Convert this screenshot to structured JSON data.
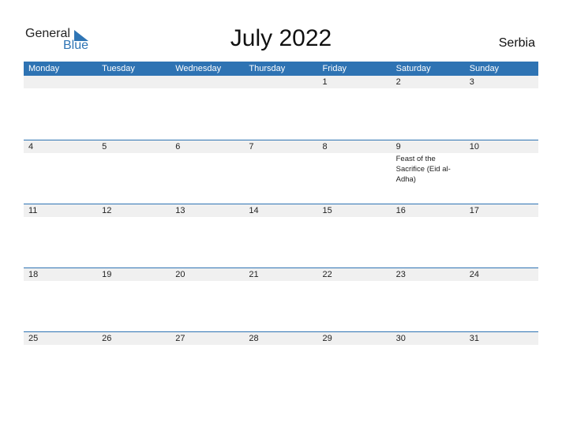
{
  "logo": {
    "general": "General",
    "blue": "Blue"
  },
  "title": "July 2022",
  "country": "Serbia",
  "weekdays": [
    "Monday",
    "Tuesday",
    "Wednesday",
    "Thursday",
    "Friday",
    "Saturday",
    "Sunday"
  ],
  "weeks": [
    {
      "days": [
        "",
        "",
        "",
        "",
        "1",
        "2",
        "3"
      ],
      "notes": [
        "",
        "",
        "",
        "",
        "",
        "",
        ""
      ]
    },
    {
      "days": [
        "4",
        "5",
        "6",
        "7",
        "8",
        "9",
        "10"
      ],
      "notes": [
        "",
        "",
        "",
        "",
        "",
        "Feast of the Sacrifice (Eid al-Adha)",
        ""
      ]
    },
    {
      "days": [
        "11",
        "12",
        "13",
        "14",
        "15",
        "16",
        "17"
      ],
      "notes": [
        "",
        "",
        "",
        "",
        "",
        "",
        ""
      ]
    },
    {
      "days": [
        "18",
        "19",
        "20",
        "21",
        "22",
        "23",
        "24"
      ],
      "notes": [
        "",
        "",
        "",
        "",
        "",
        "",
        ""
      ]
    },
    {
      "days": [
        "25",
        "26",
        "27",
        "28",
        "29",
        "30",
        "31"
      ],
      "notes": [
        "",
        "",
        "",
        "",
        "",
        "",
        ""
      ]
    }
  ]
}
